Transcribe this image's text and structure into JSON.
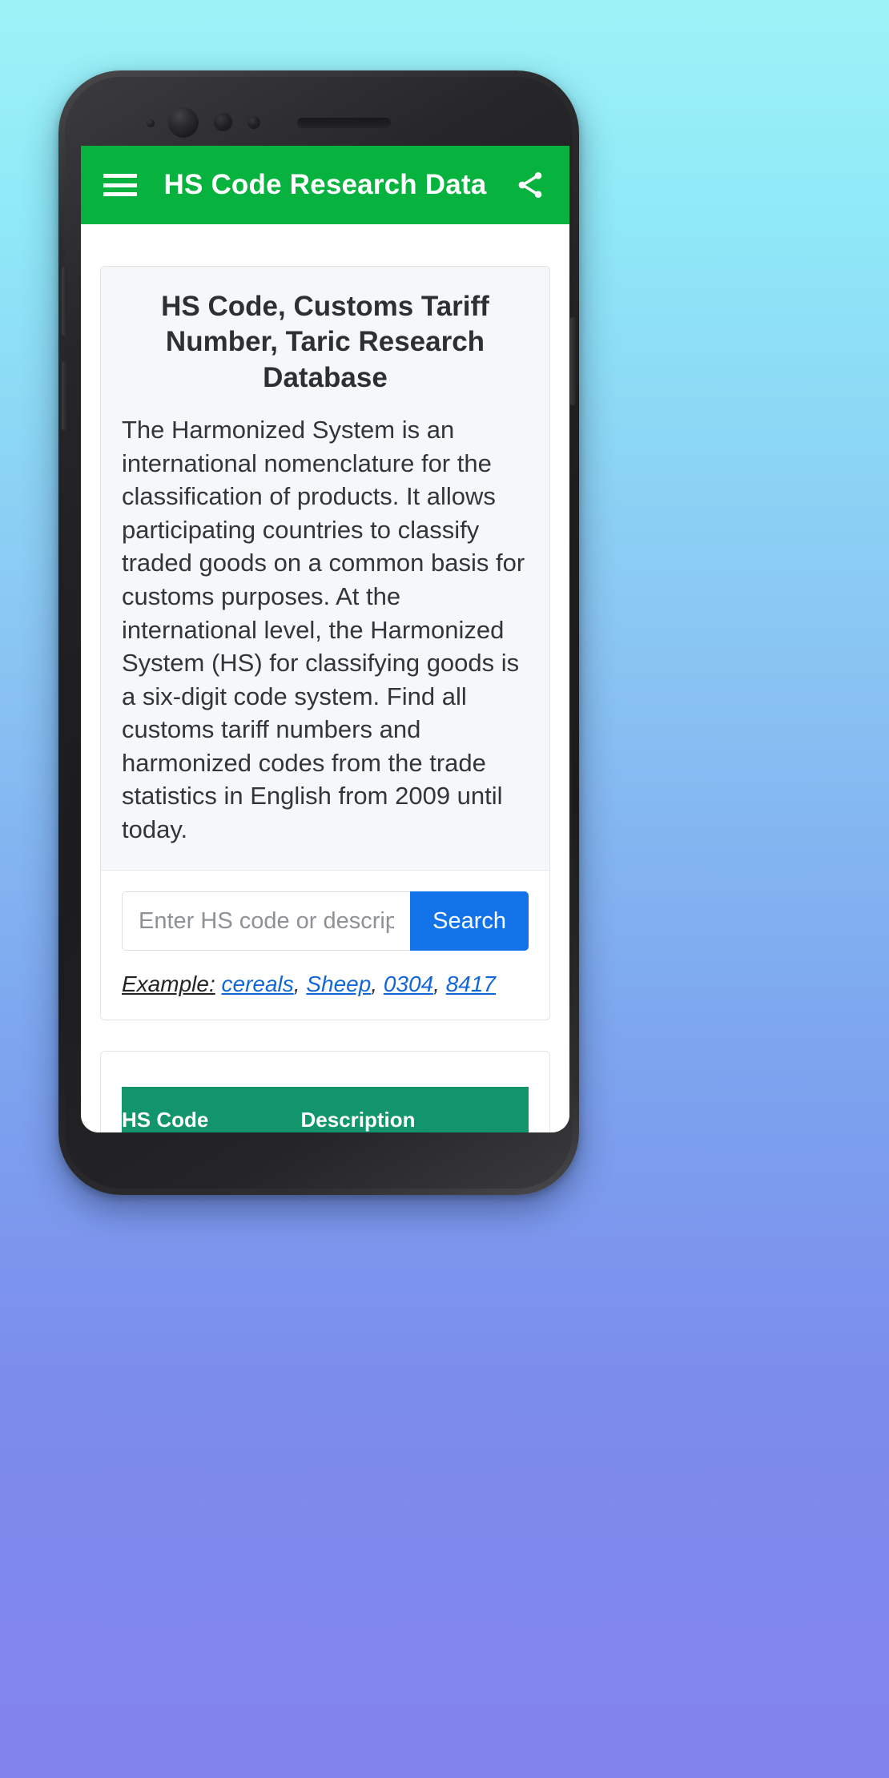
{
  "app": {
    "title": "HS Code Research Data",
    "menu_icon": "hamburger-menu-icon",
    "share_icon": "share-icon",
    "appbar_color": "#07b23f"
  },
  "info_card": {
    "title": "HS Code, Customs Tariff Number, Taric Research Database",
    "paragraph": "The Harmonized System is an international nomenclature for the classification of products. It allows participating countries to classify traded goods on a common basis for customs purposes. At the international level, the Harmonized System (HS) for classifying goods is a six-digit code system. Find all customs tariff numbers and harmonized codes from the trade statistics in English from 2009 until today."
  },
  "search": {
    "placeholder": "Enter HS code or description",
    "value": "",
    "button_label": "Search",
    "button_color": "#1272e8",
    "example_label": "Example:",
    "examples": [
      {
        "text": "cereals",
        "separator": ", "
      },
      {
        "text": "Sheep",
        "separator": ", "
      },
      {
        "text": "0304",
        "separator": ", "
      },
      {
        "text": "8417",
        "separator": ""
      }
    ]
  },
  "results": {
    "header_color": "#12956b",
    "columns": [
      "HS Code",
      "Description"
    ],
    "rows": []
  },
  "device": {
    "sensors": [
      "sensor-dot",
      "front-camera",
      "proximity-sensor",
      "light-sensor",
      "earpiece-speaker"
    ]
  }
}
